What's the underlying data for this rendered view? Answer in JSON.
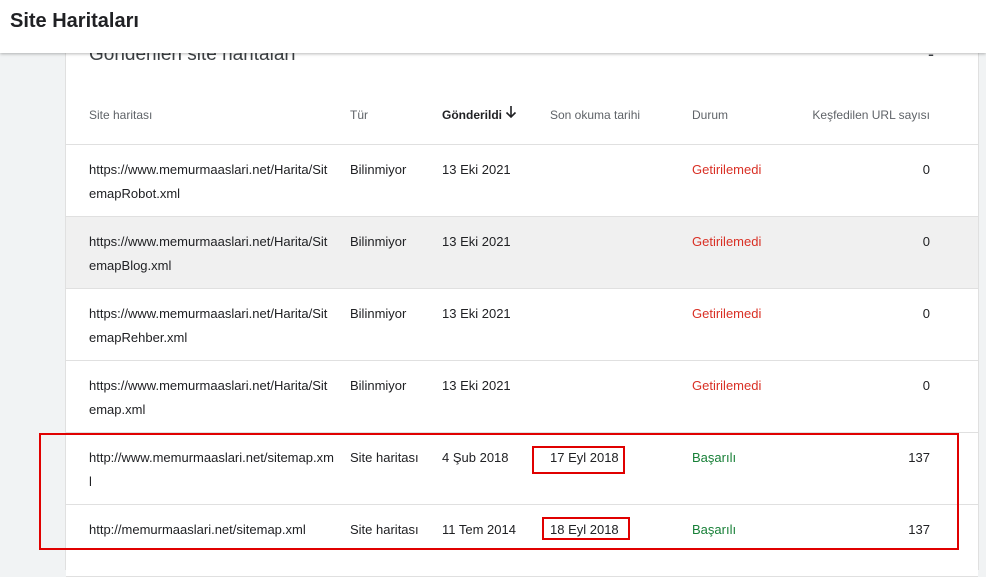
{
  "header": {
    "title": "Site Haritaları"
  },
  "card": {
    "title": "Gönderilen site haritaları",
    "collapse_label": "-"
  },
  "columns": {
    "sitemap": "Site haritası",
    "type": "Tür",
    "submitted": "Gönderildi",
    "last_read": "Son okuma tarihi",
    "status": "Durum",
    "discovered": "Keşfedilen URL sayısı"
  },
  "rows": [
    {
      "url": "https://www.memurmaaslari.net/Harita/SitemapRobot.xml",
      "type": "Bilinmiyor",
      "submitted": "13 Eki 2021",
      "last_read": "",
      "status": "Getirilemedi",
      "status_kind": "fail",
      "count": "0"
    },
    {
      "url": "https://www.memurmaaslari.net/Harita/SitemapBlog.xml",
      "type": "Bilinmiyor",
      "submitted": "13 Eki 2021",
      "last_read": "",
      "status": "Getirilemedi",
      "status_kind": "fail",
      "count": "0"
    },
    {
      "url": "https://www.memurmaaslari.net/Harita/SitemapRehber.xml",
      "type": "Bilinmiyor",
      "submitted": "13 Eki 2021",
      "last_read": "",
      "status": "Getirilemedi",
      "status_kind": "fail",
      "count": "0"
    },
    {
      "url": "https://www.memurmaaslari.net/Harita/Sitemap.xml",
      "type": "Bilinmiyor",
      "submitted": "13 Eki 2021",
      "last_read": "",
      "status": "Getirilemedi",
      "status_kind": "fail",
      "count": "0"
    },
    {
      "url": "http://www.memurmaaslari.net/sitemap.xml",
      "type": "Site haritası",
      "submitted": "4 Şub 2018",
      "last_read": "17 Eyl 2018",
      "status": "Başarılı",
      "status_kind": "ok",
      "count": "137"
    },
    {
      "url": "http://memurmaaslari.net/sitemap.xml",
      "type": "Site haritası",
      "submitted": "11 Tem 2014",
      "last_read": "18 Eyl 2018",
      "status": "Başarılı",
      "status_kind": "ok",
      "count": "137"
    }
  ],
  "colors": {
    "fail": "#d93025",
    "ok": "#188038",
    "highlight": "#e00000"
  }
}
